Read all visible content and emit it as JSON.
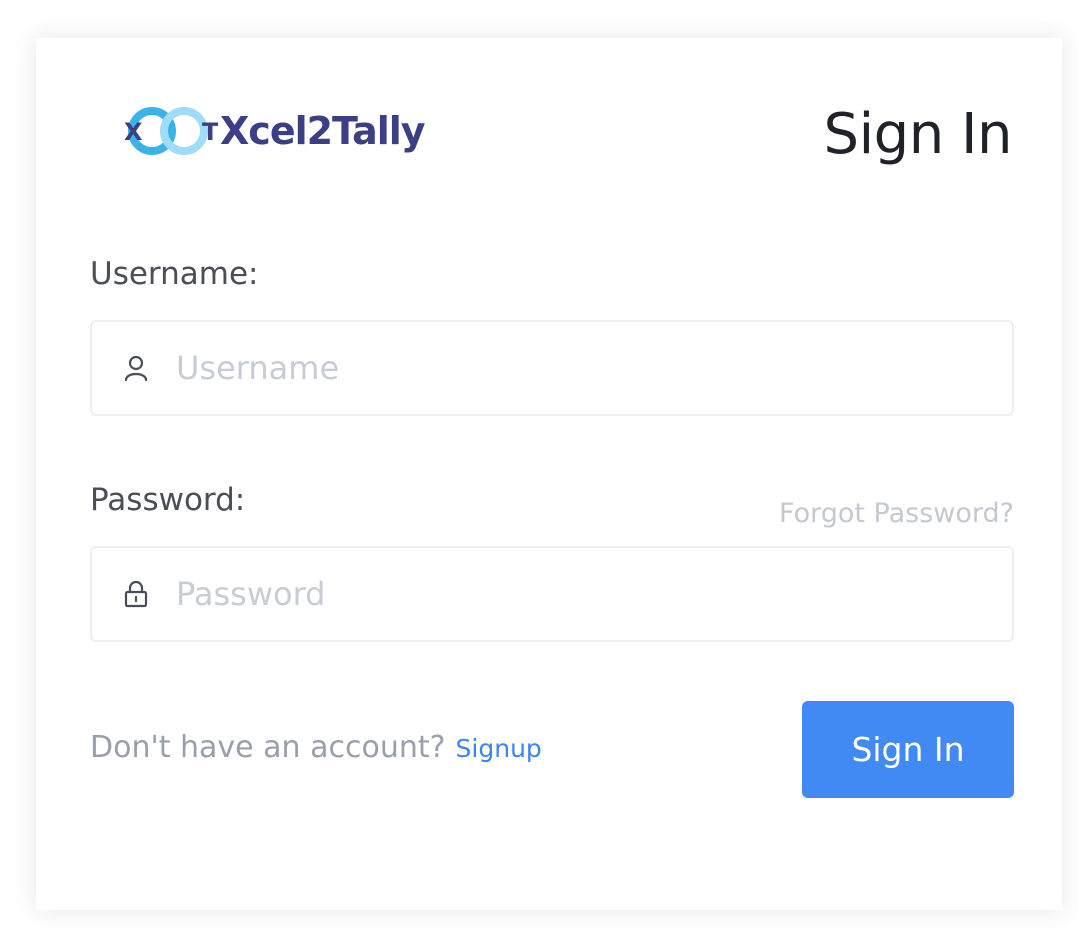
{
  "brand": {
    "logo_text": "Xcel2Tally",
    "logo_icon_letters": [
      "X",
      "T"
    ],
    "colors": {
      "logo_text": "#3a3f86",
      "logo_ring": "#3bb3e8"
    }
  },
  "page": {
    "title": "Sign In"
  },
  "form": {
    "username": {
      "label": "Username:",
      "placeholder": "Username",
      "value": "",
      "icon": "user-icon"
    },
    "password": {
      "label": "Password:",
      "placeholder": "Password",
      "value": "",
      "icon": "lock-icon"
    },
    "forgot_label": "Forgot Password?",
    "account_prompt": "Don't have an account?",
    "signup_label": "Signup",
    "submit_label": "Sign In"
  },
  "theme": {
    "accent": "#418af3",
    "link": "#3f83f0",
    "muted_text": "#9aa0ab",
    "input_border": "#ebeef4"
  }
}
